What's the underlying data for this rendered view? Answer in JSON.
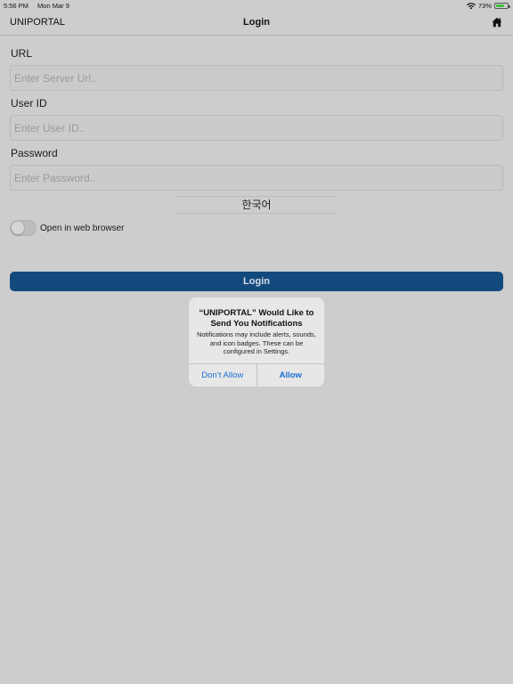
{
  "status_bar": {
    "time": "5:56 PM",
    "date": "Mon Mar 9",
    "battery_percent": "73%",
    "battery_level": 0.73,
    "battery_color": "#3fbf3f"
  },
  "nav": {
    "app_name": "UNIPORTAL",
    "title": "Login",
    "home_icon": "home-icon"
  },
  "form": {
    "url_label": "URL",
    "url_placeholder": "Enter Server Url..",
    "url_value": "",
    "user_label": "User ID",
    "user_placeholder": "Enter User ID..",
    "user_value": "",
    "password_label": "Password",
    "password_placeholder": "Enter Password..",
    "password_value": "",
    "language": "한국어",
    "browser_toggle_label": "Open in web browser",
    "browser_toggle_on": false,
    "login_label": "Login"
  },
  "alert": {
    "title": "“UNIPORTAL” Would Like to Send You Notifications",
    "message": "Notifications may include alerts, sounds, and icon badges. These can be configured in Settings.",
    "deny_label": "Don’t Allow",
    "allow_label": "Allow"
  },
  "colors": {
    "background": "#cdcdcd",
    "login_button": "#134a7e",
    "alert_button_text": "#1a6fd1"
  }
}
